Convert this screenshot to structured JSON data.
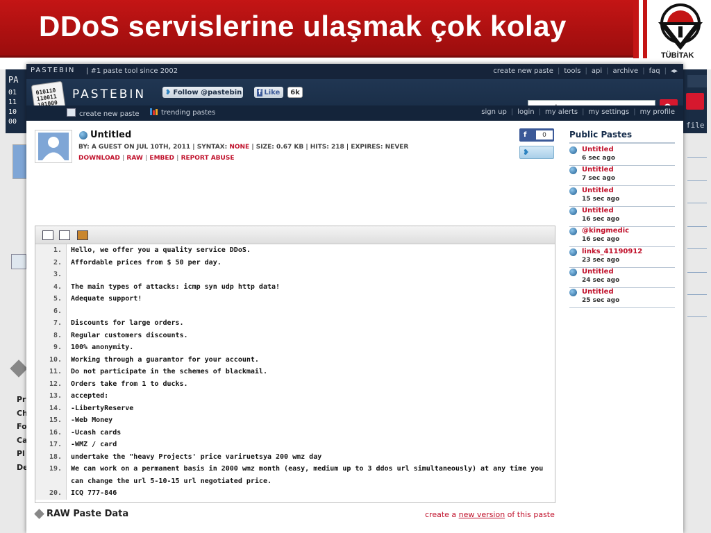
{
  "slide": {
    "title": "DDoS servislerine ulaşmak çok kolay",
    "logo_text": "TÜBİTAK",
    "title_bg_color": "#b31212"
  },
  "background_page": {
    "fragments_left": [
      "PA",
      "01",
      "11",
      "10",
      "00"
    ],
    "fragments_right": [
      "file"
    ],
    "sidebar_fragments": [
      "Pr",
      "Ch",
      "Fo",
      "Ca",
      "Pl",
      "De"
    ]
  },
  "pastebin": {
    "top_brand": "PASTEBIN",
    "tagline": "#1 paste tool since 2002",
    "top_nav": [
      "create new paste",
      "tools",
      "api",
      "archive",
      "faq"
    ],
    "brand": "PASTEBIN",
    "follow_label": "Follow @pastebin",
    "like_label": "Like",
    "like_count": "6k",
    "search_placeholder": "search...",
    "sub_nav": {
      "create": "create new paste",
      "trending": "trending pastes"
    },
    "user_links": [
      "sign up",
      "login",
      "my alerts",
      "my settings",
      "my profile"
    ]
  },
  "paste": {
    "title": "Untitled",
    "meta_prefix": "BY: A GUEST ON JUL 10TH, 2011 | SYNTAX: ",
    "syntax": "NONE",
    "meta_suffix": " | SIZE: 0.67 KB | HITS: 218 | EXPIRES: NEVER",
    "actions": [
      "DOWNLOAD",
      "RAW",
      "EMBED",
      "REPORT ABUSE"
    ],
    "fb_count": "0",
    "lines": [
      {
        "n": "1.",
        "t": "Hello, we offer you a quality service DDoS."
      },
      {
        "n": "2.",
        "t": "Affordable prices from $ 50 per day."
      },
      {
        "n": "3.",
        "t": ""
      },
      {
        "n": "4.",
        "t": "The main types of attacks: icmp syn udp http data!"
      },
      {
        "n": "5.",
        "t": "Adequate support!"
      },
      {
        "n": "6.",
        "t": ""
      },
      {
        "n": "7.",
        "t": "Discounts for large orders."
      },
      {
        "n": "8.",
        "t": "Regular customers discounts."
      },
      {
        "n": "9.",
        "t": "100% anonymity."
      },
      {
        "n": "10.",
        "t": "Working through a guarantor for your account."
      },
      {
        "n": "11.",
        "t": "Do not participate in the schemes of blackmail."
      },
      {
        "n": "12.",
        "t": "Orders take from 1 to ducks."
      },
      {
        "n": "13.",
        "t": "accepted:"
      },
      {
        "n": "14.",
        "t": "-LibertyReserve"
      },
      {
        "n": "15.",
        "t": "-Web Money"
      },
      {
        "n": "16.",
        "t": "-Ucash cards"
      },
      {
        "n": "17.",
        "t": "-WMZ / card"
      },
      {
        "n": "18.",
        "t": "undertake the \"heavy Projects' price variruetsya 200 wmz day"
      },
      {
        "n": "19.",
        "t": "We can work on a permanent basis in 2000 wmz month (easy, medium up to 3 ddos url simultaneously) at any time you can change the url 5-10-15 url negotiated price."
      },
      {
        "n": "20.",
        "t": "ICQ 777-846"
      }
    ],
    "raw_heading": "RAW Paste Data",
    "create_prefix": "create a ",
    "create_link": "new version",
    "create_suffix": " of this paste"
  },
  "sidebar": {
    "title": "Public Pastes",
    "items": [
      {
        "name": "Untitled",
        "time": "6 sec ago"
      },
      {
        "name": "Untitled",
        "time": "7 sec ago"
      },
      {
        "name": "Untitled",
        "time": "15 sec ago"
      },
      {
        "name": "Untitled",
        "time": "16 sec ago"
      },
      {
        "name": "@kingmedic",
        "time": "16 sec ago"
      },
      {
        "name": "links_41190912",
        "time": "23 sec ago"
      },
      {
        "name": "Untitled",
        "time": "24 sec ago"
      },
      {
        "name": "Untitled",
        "time": "25 sec ago"
      }
    ]
  }
}
